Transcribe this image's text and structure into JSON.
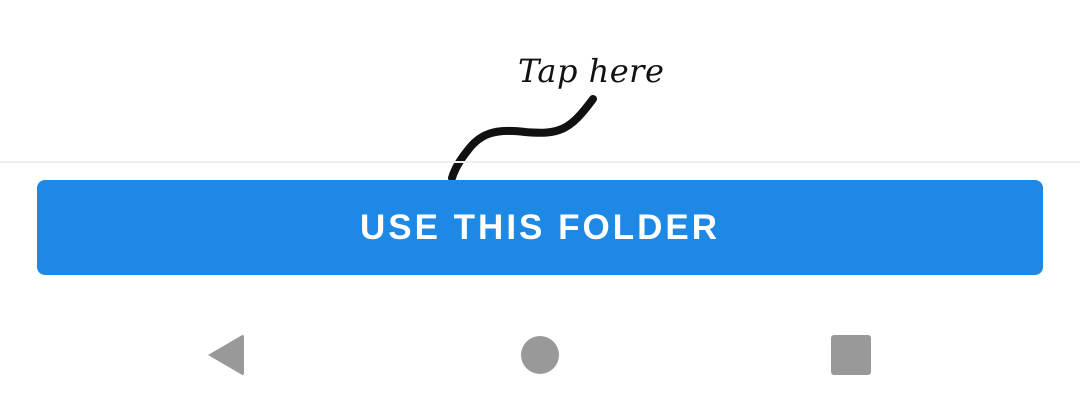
{
  "annotation": {
    "label": "Tap here"
  },
  "action": {
    "primary_button_label": "USE THIS FOLDER"
  },
  "navigation_bar": {
    "back_icon": "back-triangle-icon",
    "home_icon": "home-circle-icon",
    "recents_icon": "recents-square-icon"
  },
  "colors": {
    "button_background": "#1e88e5",
    "button_text": "#ffffff",
    "nav_icon": "#999999",
    "annotation_ink": "#111111"
  }
}
